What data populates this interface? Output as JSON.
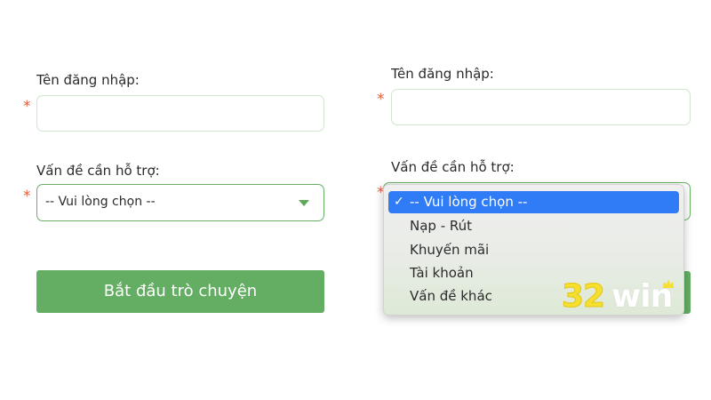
{
  "colors": {
    "accent_green": "#64ae63",
    "required_star": "#e65a3a",
    "selected_blue": "#2f7cf6",
    "logo_yellow": "#f6df2e"
  },
  "left": {
    "username_label": "Tên đăng nhập:",
    "username_value": "",
    "required_mark": "*",
    "issue_label": "Vấn đề cần hỗ trợ:",
    "issue_selected": "-- Vui lòng chọn --",
    "start_button": "Bắt đầu trò chuyện"
  },
  "right": {
    "username_label": "Tên đăng nhập:",
    "username_value": "",
    "required_mark": "*",
    "issue_label": "Vấn đề cần hỗ trợ:",
    "dropdown_options": [
      {
        "label": "-- Vui lòng chọn --",
        "selected": true
      },
      {
        "label": "Nạp - Rút",
        "selected": false
      },
      {
        "label": "Khuyến mãi",
        "selected": false
      },
      {
        "label": "Tài khoản",
        "selected": false
      },
      {
        "label": "Vấn đề khác",
        "selected": false
      }
    ],
    "check_glyph": "✓"
  },
  "watermark": {
    "number": "32",
    "word": "win"
  }
}
